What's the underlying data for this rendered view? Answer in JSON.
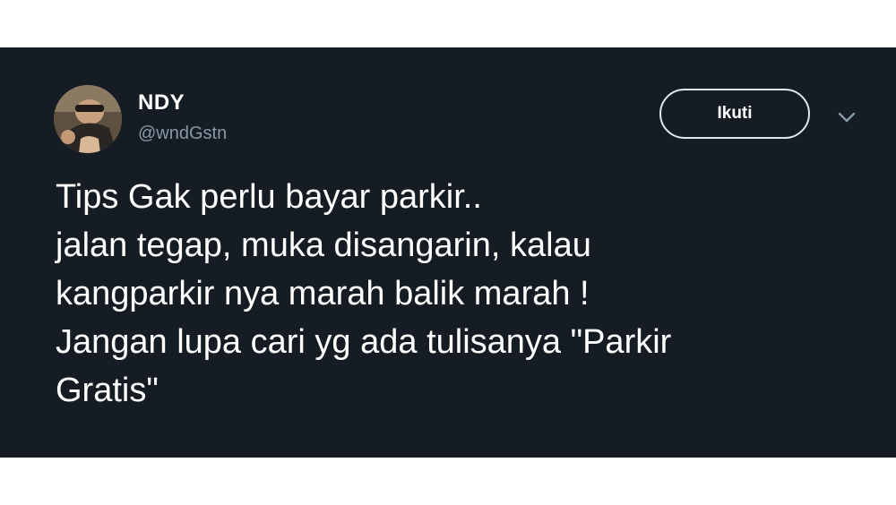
{
  "tweet": {
    "display_name": "NDY",
    "handle": "@wndGstn",
    "follow_label": "Ikuti",
    "text": "Tips Gak perlu bayar parkir..\njalan tegap, muka disangarin, kalau\nkangparkir nya marah balik marah !\nJangan lupa cari yg ada tulisanya \"Parkir\nGratis\""
  },
  "icons": {
    "more_menu": "chevron-down-icon",
    "avatar": "profile-photo"
  },
  "colors": {
    "card_background": "#151c24",
    "page_background": "#ffffff",
    "text_primary": "#ffffff",
    "text_secondary": "#8899a6",
    "button_border": "#e1e8ed"
  }
}
